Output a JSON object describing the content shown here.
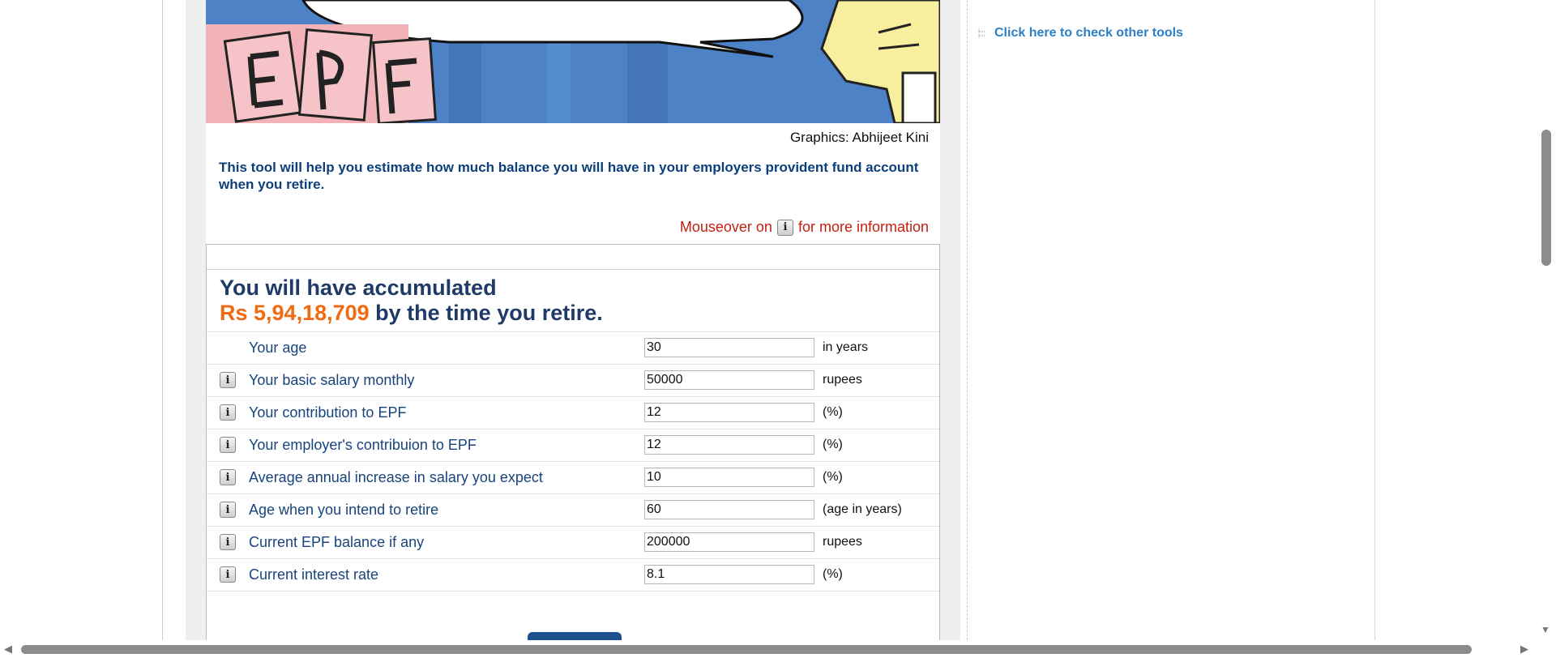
{
  "credit": "Graphics: Abhijeet Kini",
  "intro": "This tool will help you estimate how much balance you will have in your employers provident fund account when you retire.",
  "mouseover": {
    "before": "Mouseover on",
    "after": "for more information",
    "icon_glyph": "i"
  },
  "result": {
    "line1": "You will have accumulated",
    "amount": "Rs 5,94,18,709",
    "suffix": "by the time you retire."
  },
  "fields": [
    {
      "label": "Your age",
      "value": "30",
      "unit": "in years",
      "has_info": false
    },
    {
      "label": "Your basic salary monthly",
      "value": "50000",
      "unit": "rupees",
      "has_info": true
    },
    {
      "label": "Your contribution to EPF",
      "value": "12",
      "unit": "(%)",
      "has_info": true
    },
    {
      "label": "Your employer's contribuion to EPF",
      "value": "12",
      "unit": "(%)",
      "has_info": true
    },
    {
      "label": "Average annual increase in salary you expect",
      "value": "10",
      "unit": "(%)",
      "has_info": true
    },
    {
      "label": "Age when you intend to retire",
      "value": "60",
      "unit": "(age in years)",
      "has_info": true
    },
    {
      "label": "Current EPF balance if any",
      "value": "200000",
      "unit": "rupees",
      "has_info": true
    },
    {
      "label": "Current interest rate",
      "value": "8.1",
      "unit": "(%)",
      "has_info": true
    }
  ],
  "sidebar": {
    "tools_link": "Click here to check other tools"
  },
  "colors": {
    "result_amount": "#f06a12",
    "label": "#17447d",
    "warning": "#c21f12",
    "link": "#2d80c5"
  }
}
